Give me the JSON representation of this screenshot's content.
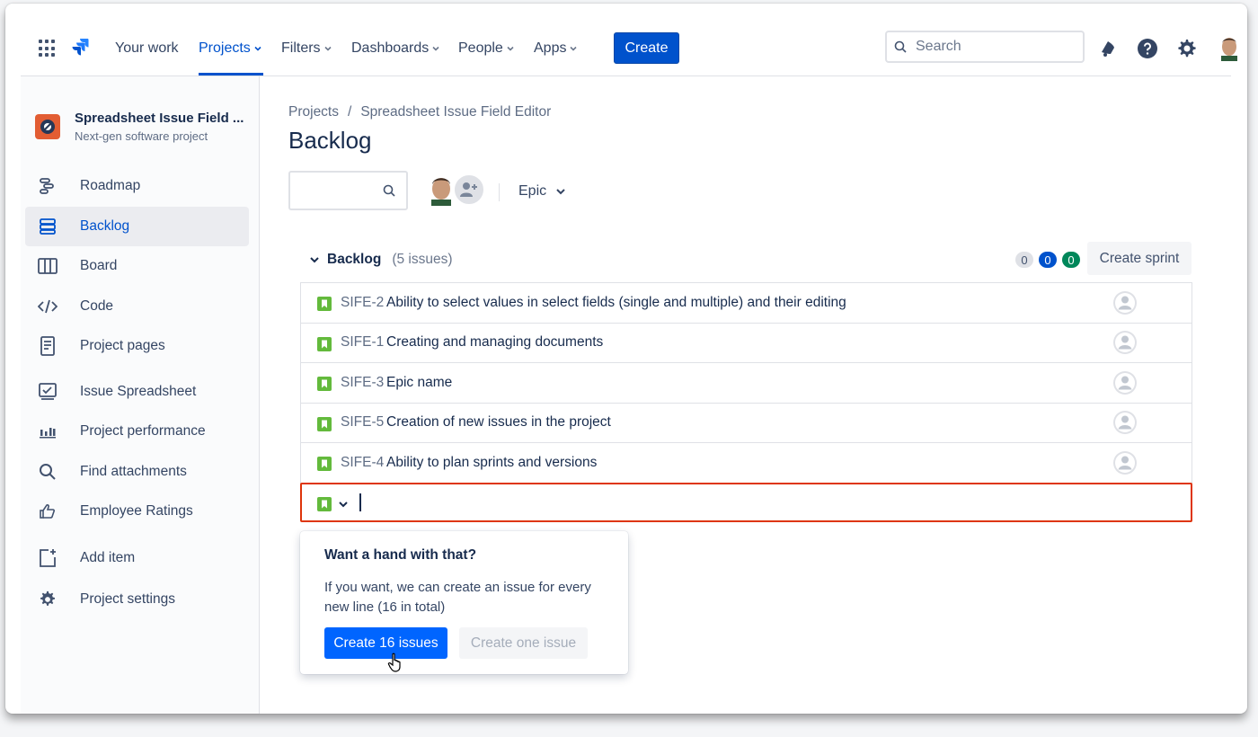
{
  "topnav": {
    "items": [
      {
        "label": "Your work",
        "has_chevron": false
      },
      {
        "label": "Projects",
        "has_chevron": true,
        "active": true
      },
      {
        "label": "Filters",
        "has_chevron": true
      },
      {
        "label": "Dashboards",
        "has_chevron": true
      },
      {
        "label": "People",
        "has_chevron": true
      },
      {
        "label": "Apps",
        "has_chevron": true
      }
    ],
    "create_label": "Create",
    "search_placeholder": "Search",
    "icons": [
      "apps-grid-icon",
      "jira-logo-icon",
      "notifications-icon",
      "help-icon",
      "settings-icon",
      "user-avatar"
    ]
  },
  "sidebar": {
    "project_name": "Spreadsheet Issue Field ...",
    "project_type": "Next-gen software project",
    "items": [
      {
        "label": "Roadmap",
        "icon": "roadmap-icon"
      },
      {
        "label": "Backlog",
        "icon": "backlog-icon",
        "active": true
      },
      {
        "label": "Board",
        "icon": "board-icon"
      },
      {
        "label": "Code",
        "icon": "code-icon"
      },
      {
        "label": "Project pages",
        "icon": "pages-icon"
      },
      {
        "label": "Issue Spreadsheet",
        "icon": "spreadsheet-icon"
      },
      {
        "label": "Project performance",
        "icon": "chart-icon"
      },
      {
        "label": "Find attachments",
        "icon": "search-icon"
      },
      {
        "label": "Employee Ratings",
        "icon": "thumbs-up-icon"
      },
      {
        "label": "Add item",
        "icon": "add-item-icon"
      },
      {
        "label": "Project settings",
        "icon": "gear-icon"
      }
    ]
  },
  "main": {
    "breadcrumb": [
      "Projects",
      "/",
      "Spreadsheet Issue Field Editor"
    ],
    "title": "Backlog",
    "epic_filter": "Epic",
    "backlog": {
      "label": "Backlog",
      "count": "(5 issues)",
      "status_counts": [
        "0",
        "0",
        "0"
      ],
      "create_sprint": "Create sprint",
      "issues": [
        {
          "key": "SIFE-2",
          "summary": "Ability to select values in select fields (single and multiple) and their editing"
        },
        {
          "key": "SIFE-1",
          "summary": "Creating and managing documents"
        },
        {
          "key": "SIFE-3",
          "summary": "Epic name"
        },
        {
          "key": "SIFE-5",
          "summary": "Creation of new issues in the project"
        },
        {
          "key": "SIFE-4",
          "summary": "Ability to plan sprints and versions"
        }
      ]
    },
    "popup": {
      "title": "Want a hand with that?",
      "text": "If you want, we can create an issue for every new line (16 in total)",
      "primary": "Create 16 issues",
      "secondary": "Create one issue"
    }
  },
  "colors": {
    "accent": "#0052cc",
    "story": "#63ba3c",
    "error_border": "#de350b"
  }
}
